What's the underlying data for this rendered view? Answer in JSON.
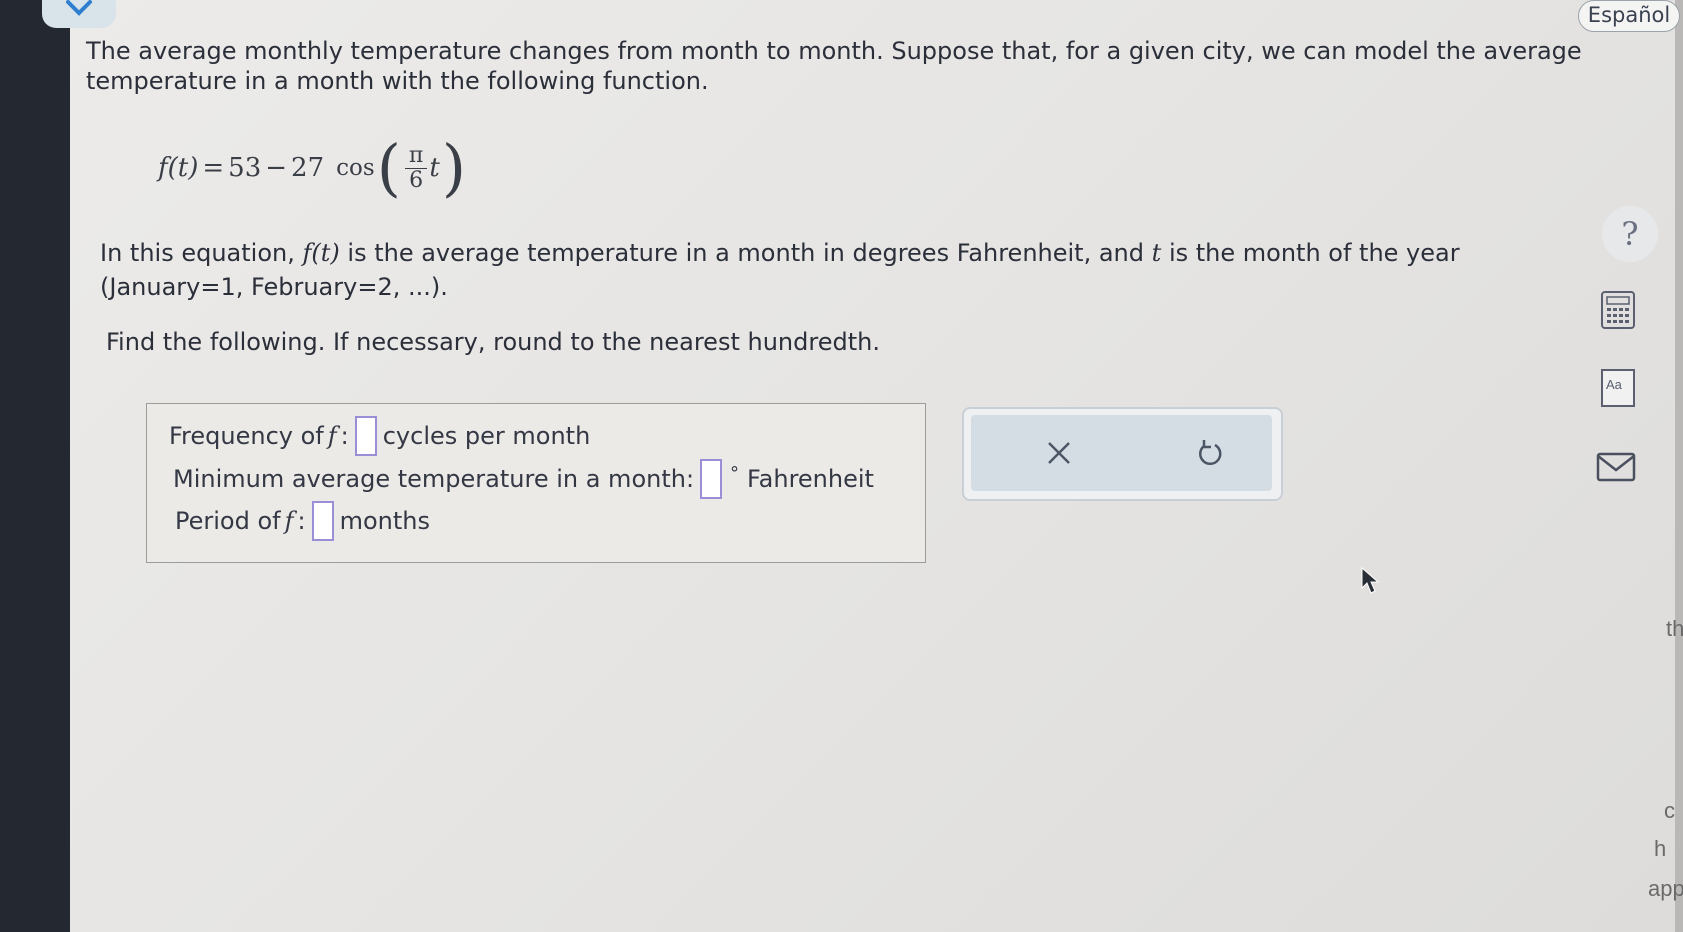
{
  "header": {
    "language_button": "Español"
  },
  "problem": {
    "intro": "The average monthly temperature changes from month to month. Suppose that, for a given city, we can model the average temperature in a month with the following function.",
    "formula": {
      "lhs": "f(t)",
      "equals": "=",
      "constant": "53",
      "minus": "−",
      "coefficient": "27",
      "function": "cos",
      "frac_num": "π",
      "frac_den": "6",
      "variable": "t"
    },
    "desc_part1": "In this equation,",
    "desc_f": "f",
    "desc_t_arg": "(t)",
    "desc_part2": "is the average temperature in a month in degrees Fahrenheit, and",
    "desc_t": "t",
    "desc_part3": "is the month of the year (January=1, February=2, ...).",
    "instruction": "Find the following. If necessary, round to the nearest hundredth."
  },
  "answers": {
    "frequency_label": "Frequency of",
    "frequency_var": "f",
    "frequency_colon": ":",
    "frequency_unit": "cycles per month",
    "frequency_value": "",
    "min_temp_label": "Minimum average temperature in a month:",
    "min_temp_degree": "°",
    "min_temp_unit": "Fahrenheit",
    "min_temp_value": "",
    "period_label": "Period of",
    "period_var": "f",
    "period_colon": ":",
    "period_unit": "months",
    "period_value": ""
  },
  "sidebar_tools": {
    "help_label": "?",
    "reference_label": "Aa"
  },
  "edge_text": [
    "th",
    "c",
    "h",
    "app"
  ],
  "colors": {
    "background": "#e8e7e5",
    "input_border": "#9a8fd6",
    "action_panel": "#d5dde4",
    "text": "#2b2f3a"
  }
}
